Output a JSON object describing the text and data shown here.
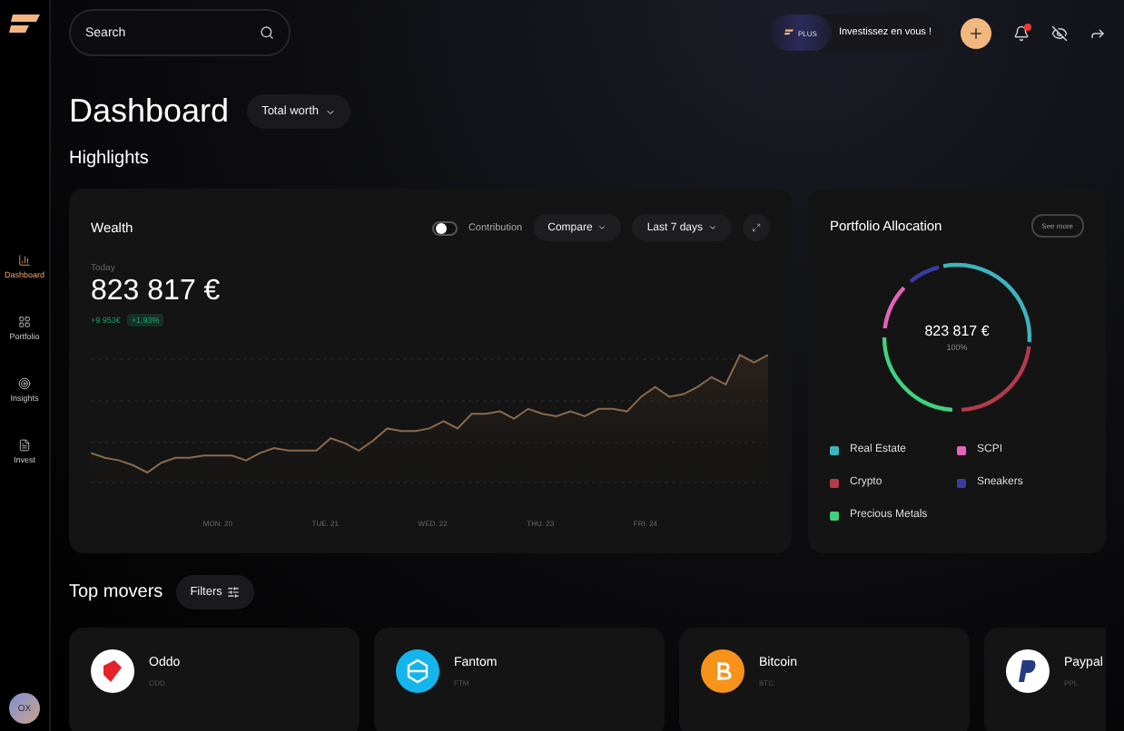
{
  "sidebar": {
    "items": [
      {
        "label": "Dashboard",
        "selected": true
      },
      {
        "label": "Portfolio",
        "selected": false
      },
      {
        "label": "Insights",
        "selected": false
      },
      {
        "label": "Invest",
        "selected": false
      }
    ],
    "avatar": "OX"
  },
  "topbar": {
    "search": {
      "placeholder": "Search"
    },
    "promo": {
      "badge": "PLUS",
      "text": "Investissez en vous !"
    },
    "notification_unread": true
  },
  "header": {
    "title": "Dashboard",
    "selector": "Total worth"
  },
  "highlights": {
    "title": "Highlights",
    "wealth": {
      "title": "Wealth",
      "contribution": {
        "label": "Contribution",
        "on": false
      },
      "compare": "Compare",
      "period": "Last 7 days",
      "caption": "Today",
      "value": "823 817 €",
      "change": "+9 953€",
      "change_pct": "+1,93%",
      "x_labels": [
        "MON. 20",
        "TUE. 21",
        "WED. 22",
        "THU. 23",
        "FRI. 24"
      ]
    },
    "allocation": {
      "title": "Portfolio Allocation",
      "see_more": "See more",
      "total": "823 817 €",
      "share": "100%",
      "legend": [
        {
          "label": "Real Estate",
          "color": "#3db5bf"
        },
        {
          "label": "SCPI",
          "color": "#e463bd"
        },
        {
          "label": "Crypto",
          "color": "#b53a4c"
        },
        {
          "label": "Sneakers",
          "color": "#3b3ba6"
        },
        {
          "label": "Precious Metals",
          "color": "#3fd27f"
        }
      ]
    }
  },
  "top_movers": {
    "title": "Top movers",
    "filter": "Filters",
    "items": [
      {
        "name": "Oddo",
        "ticker": "ODD"
      },
      {
        "name": "Fantom",
        "ticker": "FTM"
      },
      {
        "name": "Bitcoin",
        "ticker": "BTC"
      },
      {
        "name": "Paypal",
        "ticker": "PPL"
      }
    ]
  }
}
